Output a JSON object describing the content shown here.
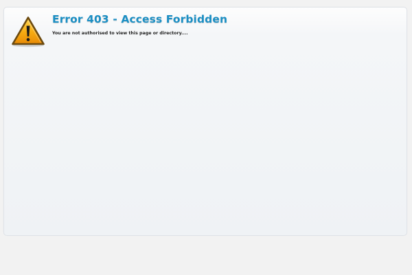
{
  "page": {
    "title": "Error 403 - Access Forbidden",
    "message": "You are not authorised to view this page or directory....",
    "icon": "warning-triangle-icon"
  },
  "colors": {
    "title": "#1b8fc4",
    "icon_fill": "#f5a90c",
    "icon_stroke": "#6b4a10",
    "panel_background": "#eff2f5",
    "page_background": "#f2f2f2"
  }
}
